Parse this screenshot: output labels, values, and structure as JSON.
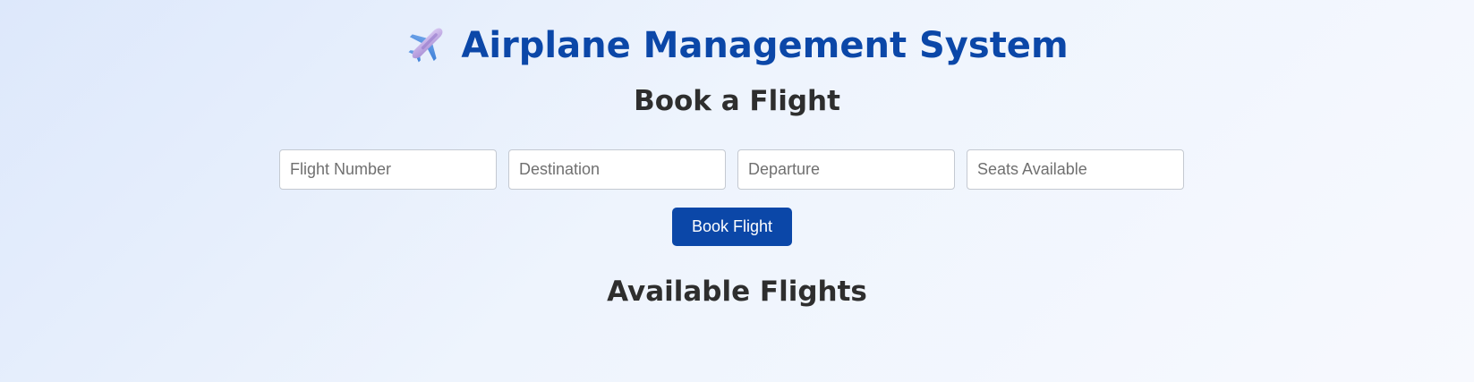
{
  "header": {
    "title": "Airplane Management System",
    "icon": "airplane-icon"
  },
  "booking": {
    "title": "Book a Flight",
    "fields": {
      "flight_number_placeholder": "Flight Number",
      "destination_placeholder": "Destination",
      "departure_placeholder": "Departure",
      "seats_placeholder": "Seats Available"
    },
    "submit_label": "Book Flight"
  },
  "flights": {
    "title": "Available Flights",
    "items": []
  },
  "colors": {
    "accent": "#0b47a8",
    "heading": "#2e2e2e",
    "background_start": "#dde8fb",
    "background_end": "#f7f9fe"
  }
}
